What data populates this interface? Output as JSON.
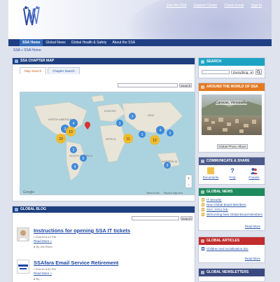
{
  "header": {
    "toplinks": [
      "Join the SSA",
      "Support Center",
      "Check Email",
      "Sign In"
    ]
  },
  "nav": {
    "items": [
      "SSA Home",
      "Global News",
      "Global Health & Safety",
      "About the SSA"
    ]
  },
  "breadcrumb": {
    "root": "SSA",
    "sep": "»",
    "current": "SSA Home"
  },
  "chapter_map": {
    "title": "SSA CHAPTER MAP",
    "tabs": [
      "Map Search",
      "Chapter Search"
    ],
    "search_button": "Search",
    "clusters": [
      "3",
      "4",
      "10",
      "23",
      "2",
      "5",
      "4",
      "11",
      "12",
      "3",
      "3",
      "3",
      "4",
      "2",
      "3"
    ],
    "map_labels": [
      "NORTH AMERICA",
      "SOUTH AMERICA",
      "AFRICA",
      "EUROPE",
      "ASIA",
      "AUSTRALIA"
    ],
    "attribution_google": "Google",
    "attribution_terms": "Terms of Use",
    "attribution_report": "Report a map error"
  },
  "global_blog": {
    "title": "GLOBAL BLOG",
    "search_button": "Search",
    "posts": [
      {
        "title": "Instructions for opening SSA IT tickets",
        "date": "3/16/16 8:42 PM",
        "read_more": "Read More »",
        "author": "By Jeb Reed"
      },
      {
        "title": "SSAfara Email Service Retirement",
        "date": "3/11/16 8:52 PM",
        "read_more": "Read More »",
        "author": "By ... "
      }
    ]
  },
  "sidebar": {
    "search": {
      "title": "SEARCH",
      "scope": "Everything"
    },
    "around": {
      "title": "AROUND THE WORLD OF SSA",
      "caption": "Caracas, Venezuela",
      "button": "Global Photo Album"
    },
    "communicate": {
      "title": "COMMUNICATE & SHARE",
      "items": [
        "Documents",
        "FAQ",
        "Forums"
      ]
    },
    "news": {
      "title": "GLOBAL NEWS",
      "items": [
        "IT Security",
        "New Global Board Members",
        "SSA_GOLLIVE",
        "Welcoming New Global Board Members"
      ],
      "more": "Read More"
    },
    "articles": {
      "title": "GLOBAL ARTICLES",
      "items": [
        "Children and socialisation.doc"
      ],
      "more": "Read More"
    },
    "newsletters": {
      "title": "GLOBAL NEWSLETTERS"
    }
  },
  "colors": {
    "nav": "#1f3f83",
    "search_head": "#1ca3c4",
    "around_head": "#e37a22",
    "communicate_head": "#4a5a8a",
    "news_head": "#1f8a5c",
    "articles_head": "#c12c2c",
    "newsletters_head": "#3a4a80",
    "cluster": "#f2b822",
    "cluster_blue": "#2f7fd8"
  }
}
